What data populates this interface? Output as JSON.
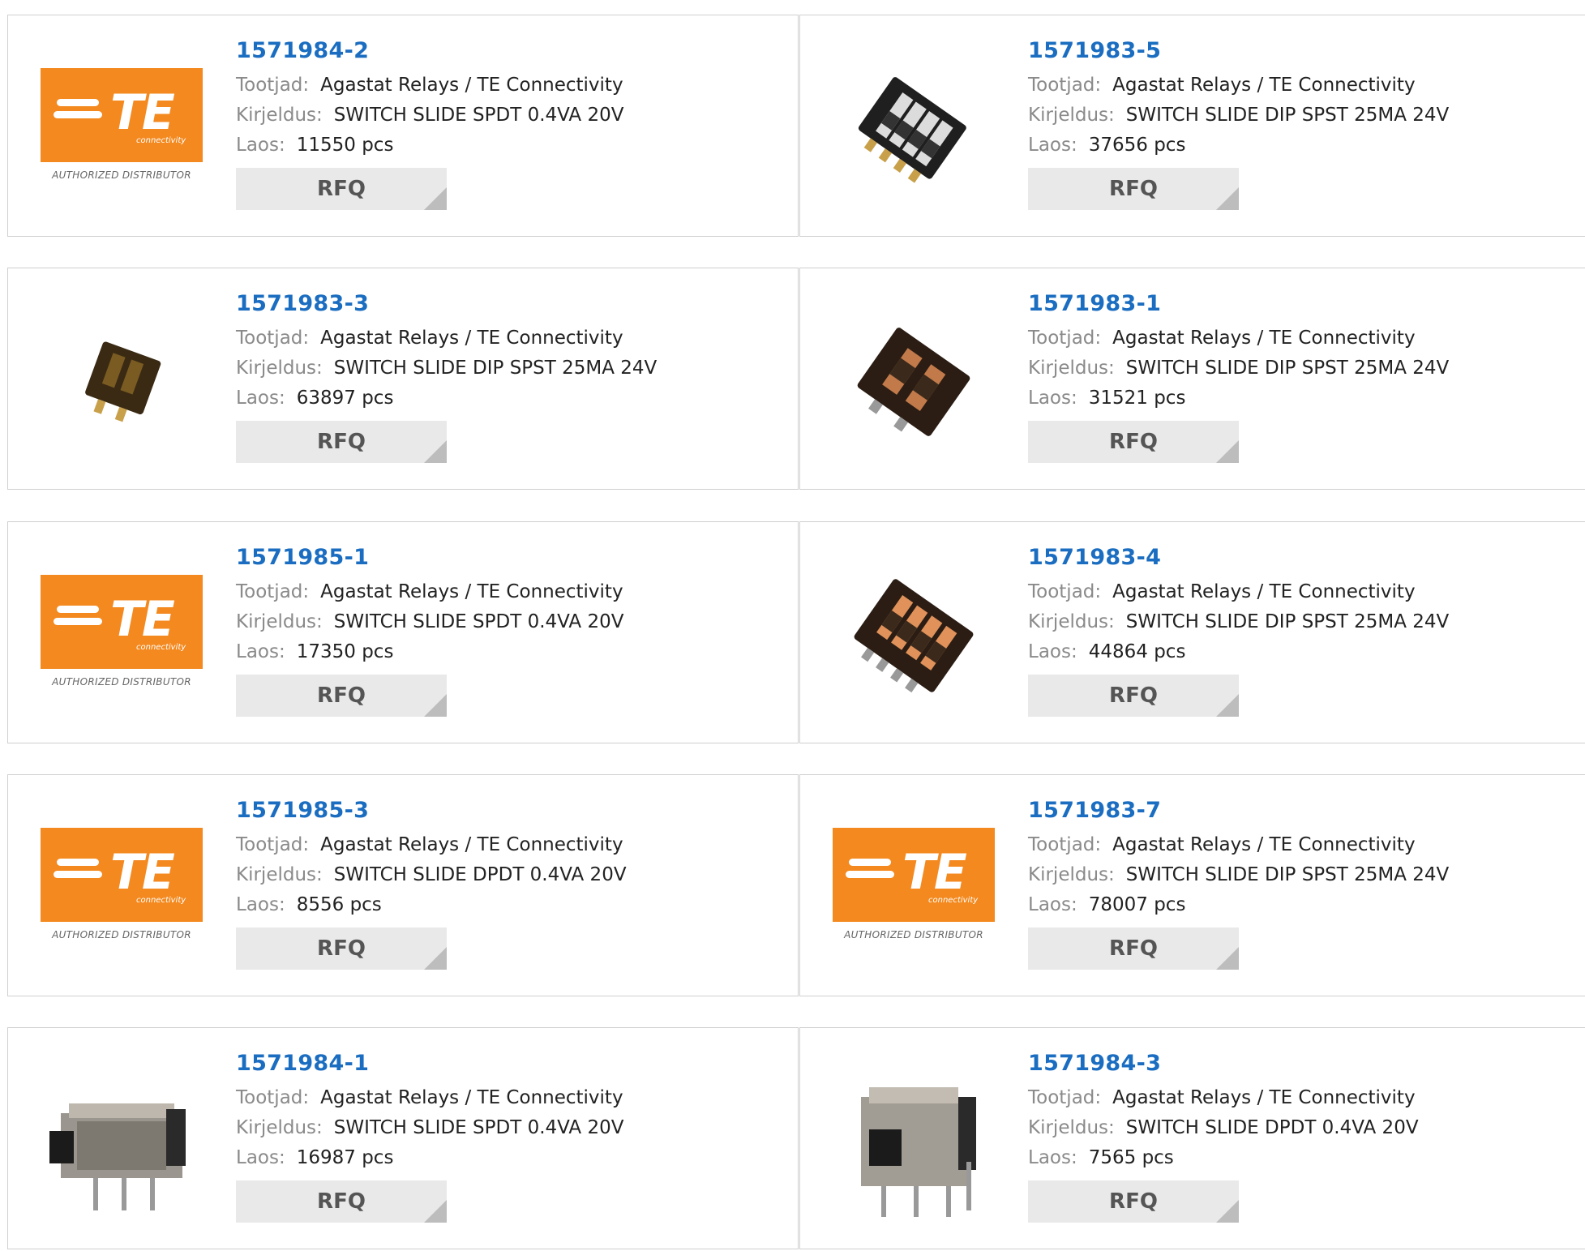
{
  "labels": {
    "manufacturer": "Tootjad:",
    "description": "Kirjeldus:",
    "stock": "Laos:",
    "rfq": "RFQ"
  },
  "logo": {
    "brand": "TE",
    "sub": "connectivity",
    "distributor": "AUTHORIZED DISTRIBUTOR",
    "color": "#f3891f"
  },
  "products": [
    {
      "pn": "1571984-2",
      "manufacturer": "Agastat Relays / TE Connectivity",
      "description": "SWITCH SLIDE SPDT 0.4VA 20V",
      "stock": "11550 pcs",
      "image": "te-logo"
    },
    {
      "pn": "1571983-5",
      "manufacturer": "Agastat Relays / TE Connectivity",
      "description": "SWITCH SLIDE DIP SPST 25MA 24V",
      "stock": "37656 pcs",
      "image": "dip-switch-4-black"
    },
    {
      "pn": "1571983-3",
      "manufacturer": "Agastat Relays / TE Connectivity",
      "description": "SWITCH SLIDE DIP SPST 25MA 24V",
      "stock": "63897 pcs",
      "image": "dip-switch-2-small"
    },
    {
      "pn": "1571983-1",
      "manufacturer": "Agastat Relays / TE Connectivity",
      "description": "SWITCH SLIDE DIP SPST 25MA 24V",
      "stock": "31521 pcs",
      "image": "dip-switch-2-brown"
    },
    {
      "pn": "1571985-1",
      "manufacturer": "Agastat Relays / TE Connectivity",
      "description": "SWITCH SLIDE SPDT 0.4VA 20V",
      "stock": "17350 pcs",
      "image": "te-logo"
    },
    {
      "pn": "1571983-4",
      "manufacturer": "Agastat Relays / TE Connectivity",
      "description": "SWITCH SLIDE DIP SPST 25MA 24V",
      "stock": "44864 pcs",
      "image": "dip-switch-4-brown"
    },
    {
      "pn": "1571985-3",
      "manufacturer": "Agastat Relays / TE Connectivity",
      "description": "SWITCH SLIDE DPDT 0.4VA 20V",
      "stock": "8556 pcs",
      "image": "te-logo"
    },
    {
      "pn": "1571983-7",
      "manufacturer": "Agastat Relays / TE Connectivity",
      "description": "SWITCH SLIDE DIP SPST 25MA 24V",
      "stock": "78007 pcs",
      "image": "te-logo"
    },
    {
      "pn": "1571984-1",
      "manufacturer": "Agastat Relays / TE Connectivity",
      "description": "SWITCH SLIDE SPDT 0.4VA 20V",
      "stock": "16987 pcs",
      "image": "slide-switch-metal"
    },
    {
      "pn": "1571984-3",
      "manufacturer": "Agastat Relays / TE Connectivity",
      "description": "SWITCH SLIDE DPDT 0.4VA 20V",
      "stock": "7565 pcs",
      "image": "slide-switch-metal-tall"
    }
  ]
}
